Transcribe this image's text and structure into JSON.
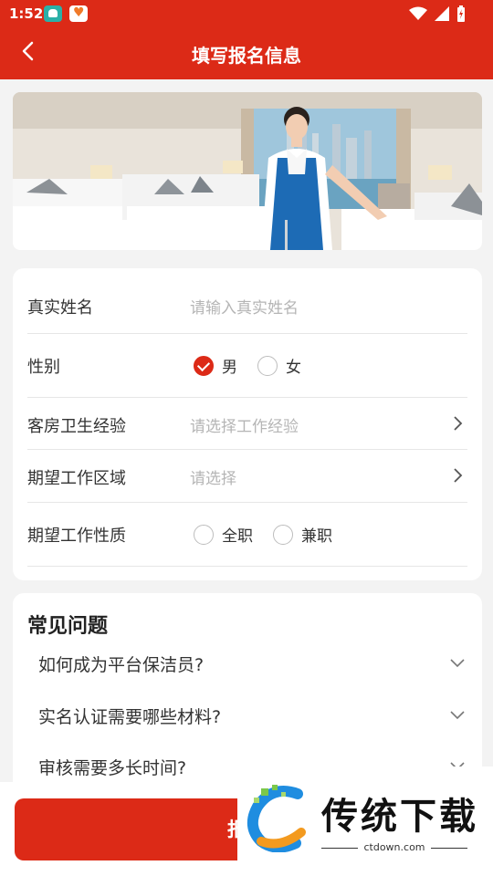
{
  "status": {
    "time": "1:52"
  },
  "header": {
    "title": "填写报名信息"
  },
  "form": {
    "name_label": "真实姓名",
    "name_placeholder": "请输入真实姓名",
    "gender_label": "性别",
    "gender_options": [
      "男",
      "女"
    ],
    "gender_selected": "男",
    "experience_label": "客房卫生经验",
    "experience_placeholder": "请选择工作经验",
    "area_label": "期望工作区域",
    "area_placeholder": "请选择",
    "jobtype_label": "期望工作性质",
    "jobtype_options": [
      "全职",
      "兼职"
    ]
  },
  "faq": {
    "title": "常见问题",
    "items": [
      "如何成为平台保洁员?",
      "实名认证需要哪些材料?",
      "审核需要多长时间?"
    ]
  },
  "bottom": {
    "submit_label": "报名"
  },
  "watermark": {
    "text": "传统下载",
    "url": "ctdown.com"
  },
  "colors": {
    "accent": "#dc2a17",
    "background": "#f3f3f3"
  }
}
